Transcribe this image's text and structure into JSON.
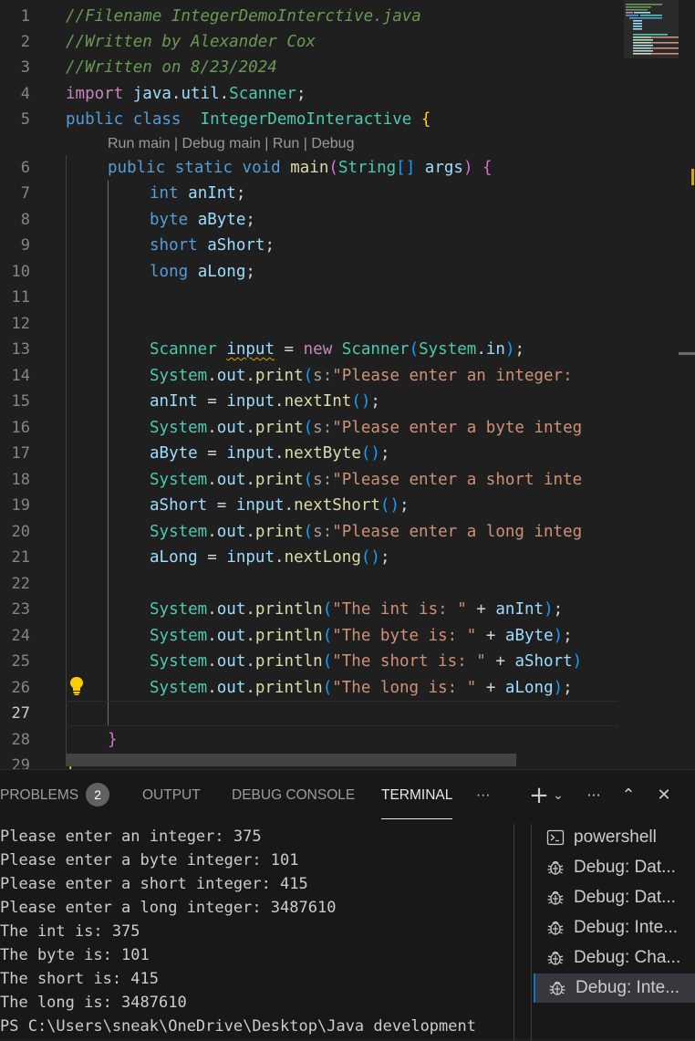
{
  "editor": {
    "line_numbers": [
      "1",
      "2",
      "3",
      "4",
      "5",
      "6",
      "7",
      "8",
      "9",
      "10",
      "11",
      "12",
      "13",
      "14",
      "15",
      "16",
      "17",
      "18",
      "19",
      "20",
      "21",
      "22",
      "23",
      "24",
      "25",
      "26",
      "27",
      "28",
      "29"
    ],
    "active_line": "27",
    "comments": {
      "l1": "//Filename IntegerDemoInterctive.java",
      "l2": "//Written by Alexander Cox",
      "l3": "//Written on 8/23/2024"
    },
    "tokens": {
      "import": "import",
      "pkg_java": "java",
      "dot": ".",
      "pkg_util": "util",
      "scanner_type": "Scanner",
      "semi": ";",
      "public": "public",
      "class": "class",
      "class_name": "IntegerDemoInteractive",
      "lbrace": "{",
      "rbrace": "}",
      "static": "static",
      "void": "void",
      "main": "main",
      "lparen": "(",
      "rparen": ")",
      "string_type": "String",
      "brackets": "[]",
      "args": "args",
      "int": "int",
      "byte": "byte",
      "short": "short",
      "long": "long",
      "anInt": "anInt",
      "aByte": "aByte",
      "aShort": "aShort",
      "aLong": "aLong",
      "input": "input",
      "eq": "=",
      "new": "new",
      "system": "System",
      "in": "in",
      "out": "out",
      "print": "print",
      "println": "println",
      "hint_s": "s:",
      "nextInt": "nextInt",
      "nextByte": "nextByte",
      "nextShort": "nextShort",
      "nextLong": "nextLong",
      "empty_parens": "()",
      "plus": "+",
      "str_int_prompt": "\"Please enter an integer: ",
      "str_byte_prompt": "\"Please enter a byte integ",
      "str_short_prompt": "\"Please enter a short inte",
      "str_long_prompt": "\"Please enter a long integ",
      "str_int_is": "\"The int is: \"",
      "str_byte_is": "\"The byte is: \"",
      "str_short_is": "\"The short is: \"",
      "str_long_is": "\"The long is: \""
    },
    "codelens": {
      "run_main": "Run main",
      "debug_main": "Debug main",
      "run": "Run",
      "debug": "Debug",
      "separator": "|"
    }
  },
  "panel": {
    "tabs": {
      "problems": "PROBLEMS",
      "problems_count": "2",
      "output": "OUTPUT",
      "debug_console": "DEBUG CONSOLE",
      "terminal": "TERMINAL",
      "more": "···"
    },
    "active_tab": "TERMINAL",
    "toolbar": {
      "add": "+",
      "dropdown": "⌄",
      "more": "···",
      "maximize": "⌃",
      "close": "✕"
    },
    "terminal_lines": [
      "Please enter an integer: 375",
      "Please enter a byte integer: 101",
      "Please enter a short integer: 415",
      "Please enter a long integer: 3487610",
      "The int is: 375",
      "The byte is: 101",
      "The short is: 415",
      "The long is: 3487610",
      "PS C:\\Users\\sneak\\OneDrive\\Desktop\\Java development"
    ],
    "terminal_list": [
      {
        "label": "powershell",
        "icon": "terminal-icon"
      },
      {
        "label": "Debug: Dat...",
        "icon": "debug-bug-icon"
      },
      {
        "label": "Debug: Dat...",
        "icon": "debug-bug-icon"
      },
      {
        "label": "Debug: Inte...",
        "icon": "debug-bug-icon"
      },
      {
        "label": "Debug: Cha...",
        "icon": "debug-bug-icon"
      },
      {
        "label": "Debug: Inte...",
        "icon": "debug-bug-icon",
        "selected": true
      }
    ]
  },
  "colors": {
    "background": "#1f1f1f",
    "panel_background": "#181818",
    "keyword": "#569cd6",
    "control_keyword": "#c586c0",
    "type": "#4ec9b0",
    "variable": "#9cdcfe",
    "function": "#dcdcaa",
    "string": "#ce9178",
    "comment": "#6a9955",
    "accent": "#0078d4"
  }
}
